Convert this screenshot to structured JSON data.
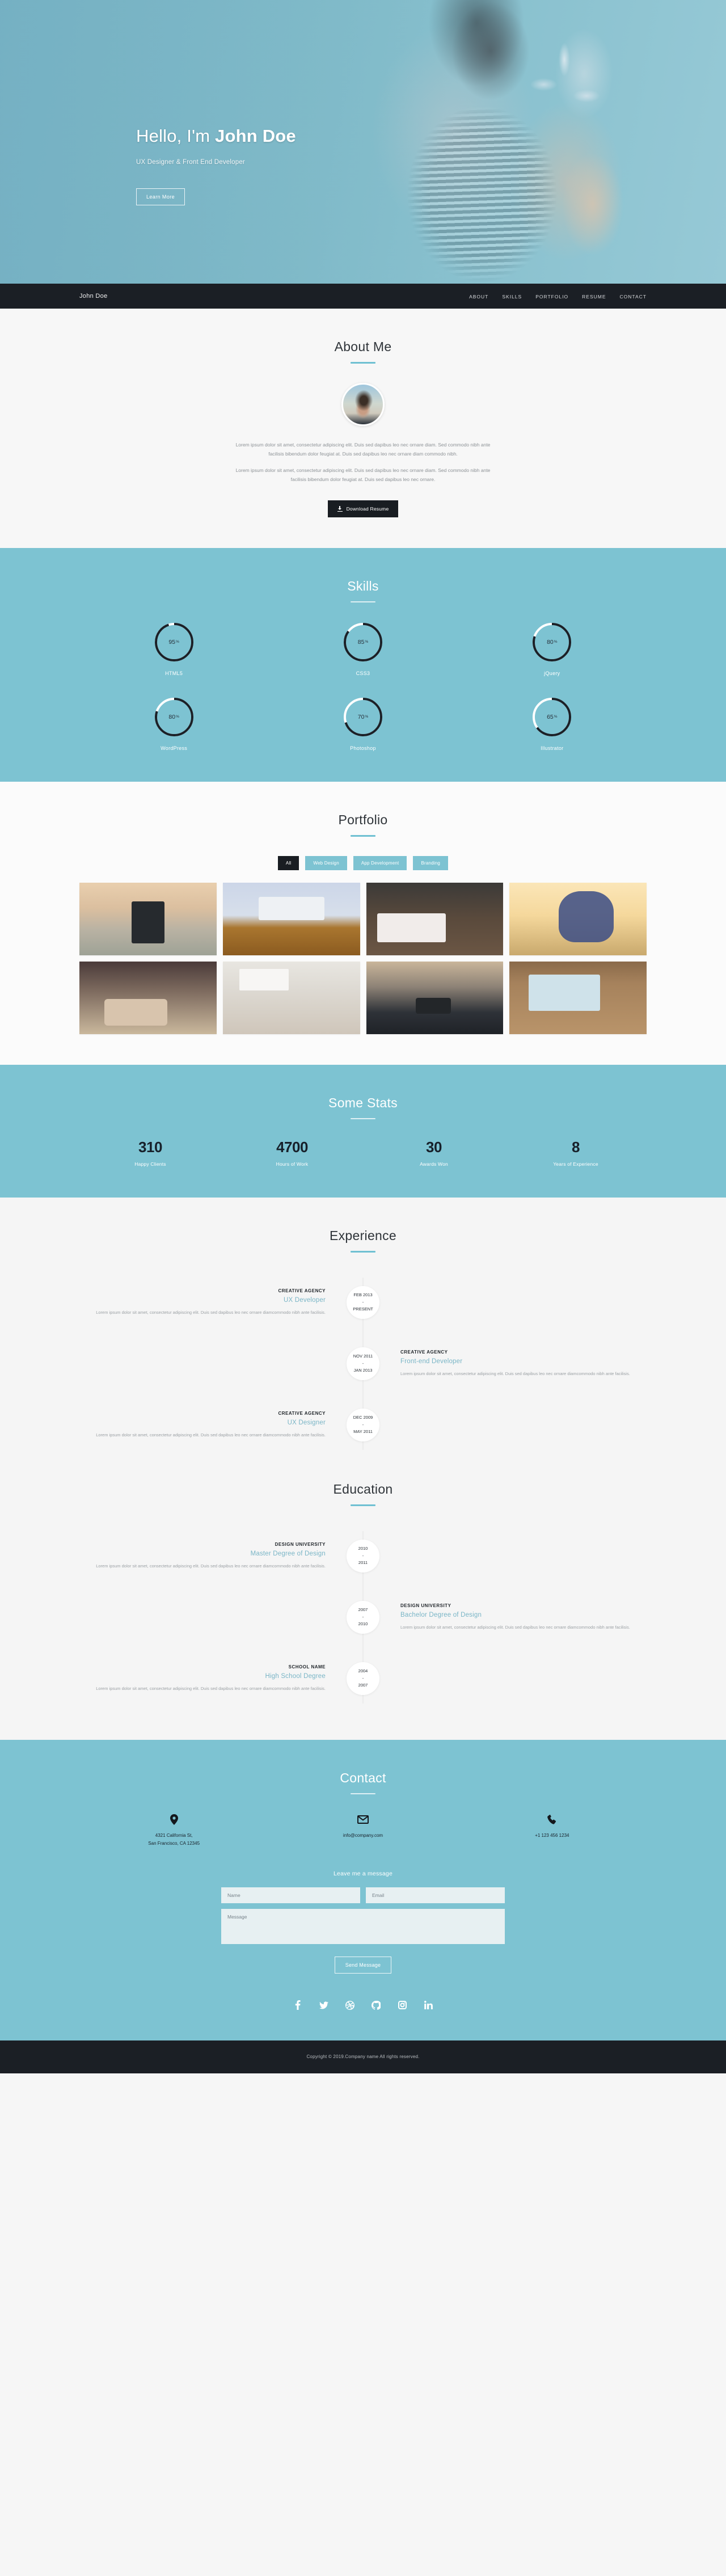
{
  "hero": {
    "greeting": "Hello, I'm ",
    "name": "John Doe",
    "subtitle": "UX Designer & Front End Developer",
    "cta": "Learn More"
  },
  "nav": {
    "brand": "John Doe",
    "items": [
      {
        "label": "ABOUT"
      },
      {
        "label": "SKILLS"
      },
      {
        "label": "PORTFOLIO"
      },
      {
        "label": "RESUME"
      },
      {
        "label": "CONTACT"
      }
    ]
  },
  "about": {
    "title": "About Me",
    "paragraph1": "Lorem ipsum dolor sit amet, consectetur adipiscing elit. Duis sed dapibus leo nec ornare diam. Sed commodo nibh ante facilisis bibendum dolor feugiat at. Duis sed dapibus leo nec ornare diam commodo nibh.",
    "paragraph2": "Lorem ipsum dolor sit amet, consectetur adipiscing elit. Duis sed dapibus leo nec ornare diam. Sed commodo nibh ante facilisis bibendum dolor feugiat at. Duis sed dapibus leo nec ornare.",
    "download_label": "Download Resume"
  },
  "skills": {
    "title": "Skills",
    "items": [
      {
        "name": "HTML5",
        "value": 95,
        "display": "95",
        "unit": "%"
      },
      {
        "name": "CSS3",
        "value": 85,
        "display": "85",
        "unit": "%"
      },
      {
        "name": "jQuery",
        "value": 80,
        "display": "80",
        "unit": "%"
      },
      {
        "name": "WordPress",
        "value": 80,
        "display": "80",
        "unit": "%"
      },
      {
        "name": "Photoshop",
        "value": 70,
        "display": "70",
        "unit": "%"
      },
      {
        "name": "Illustrator",
        "value": 65,
        "display": "65",
        "unit": "%"
      }
    ]
  },
  "portfolio": {
    "title": "Portfolio",
    "filters": [
      {
        "label": "All",
        "active": true
      },
      {
        "label": "Web Design",
        "active": false
      },
      {
        "label": "App Development",
        "active": false
      },
      {
        "label": "Branding",
        "active": false
      }
    ],
    "items": [
      {
        "alt": "hand-holding-phone-at-sunset"
      },
      {
        "alt": "laptop-and-glasses-on-desk"
      },
      {
        "alt": "imac-keyboard-and-tablet"
      },
      {
        "alt": "woman-with-sunglasses-and-necklace"
      },
      {
        "alt": "hands-typing-on-laptop"
      },
      {
        "alt": "desk-flatlay-with-notebooks"
      },
      {
        "alt": "woman-holding-camera"
      },
      {
        "alt": "macbook-and-notebook-on-wood"
      }
    ]
  },
  "stats": {
    "title": "Some Stats",
    "items": [
      {
        "value": "310",
        "label": "Happy Clients"
      },
      {
        "value": "4700",
        "label": "Hours of Work"
      },
      {
        "value": "30",
        "label": "Awards Won"
      },
      {
        "value": "8",
        "label": "Years of Experience"
      }
    ]
  },
  "experience": {
    "title": "Experience",
    "items": [
      {
        "side": "left",
        "org": "CREATIVE AGENCY",
        "role": "UX Developer",
        "desc": "Lorem ipsum dolor sit amet, consectetur adipiscing elit. Duis sed dapibus leo nec ornare diamcommodo nibh ante facilisis.",
        "date_from": "FEB 2013",
        "date_sep": "-",
        "date_to": "PRESENT"
      },
      {
        "side": "right",
        "org": "CREATIVE AGENCY",
        "role": "Front-end Developer",
        "desc": "Lorem ipsum dolor sit amet, consectetur adipiscing elit. Duis sed dapibus leo nec ornare diamcommodo nibh ante facilisis.",
        "date_from": "NOV 2011",
        "date_sep": "-",
        "date_to": "JAN 2013"
      },
      {
        "side": "left",
        "org": "CREATIVE AGENCY",
        "role": "UX Designer",
        "desc": "Lorem ipsum dolor sit amet, consectetur adipiscing elit. Duis sed dapibus leo nec ornare diamcommodo nibh ante facilisis.",
        "date_from": "DEC 2009",
        "date_sep": "-",
        "date_to": "MAY 2011"
      }
    ]
  },
  "education": {
    "title": "Education",
    "items": [
      {
        "side": "left",
        "org": "DESIGN UNIVERSITY",
        "role": "Master Degree of Design",
        "desc": "Lorem ipsum dolor sit amet, consectetur adipiscing elit. Duis sed dapibus leo nec ornare diamcommodo nibh ante facilisis.",
        "date_from": "2010",
        "date_sep": "-",
        "date_to": "2011"
      },
      {
        "side": "right",
        "org": "DESIGN UNIVERSITY",
        "role": "Bachelor Degree of Design",
        "desc": "Lorem ipsum dolor sit amet, consectetur adipiscing elit. Duis sed dapibus leo nec ornare diamcommodo nibh ante facilisis.",
        "date_from": "2007",
        "date_sep": "-",
        "date_to": "2010"
      },
      {
        "side": "left",
        "org": "SCHOOL NAME",
        "role": "High School Degree",
        "desc": "Lorem ipsum dolor sit amet, consectetur adipiscing elit. Duis sed dapibus leo nec ornare diamcommodo nibh ante facilisis.",
        "date_from": "2004",
        "date_sep": "-",
        "date_to": "2007"
      }
    ]
  },
  "contact": {
    "title": "Contact",
    "address_line1": "4321 California St,",
    "address_line2": "San Francisco, CA 12345",
    "email": "info@company.com",
    "phone": "+1 123 456 1234",
    "form_heading": "Leave me a message",
    "name_placeholder": "Name",
    "email_placeholder": "Email",
    "message_placeholder": "Message",
    "send_label": "Send Message",
    "socials": [
      {
        "name": "facebook"
      },
      {
        "name": "twitter"
      },
      {
        "name": "dribbble"
      },
      {
        "name": "github"
      },
      {
        "name": "instagram"
      },
      {
        "name": "linkedin"
      }
    ]
  },
  "footer": {
    "copyright": "Copyright © 2019.Company name All rights reserved."
  },
  "colors": {
    "accent_blue": "#7dc3d2",
    "dark": "#1b1f25",
    "rule": "#6fc0d2",
    "role_blue": "#79b5c6"
  }
}
